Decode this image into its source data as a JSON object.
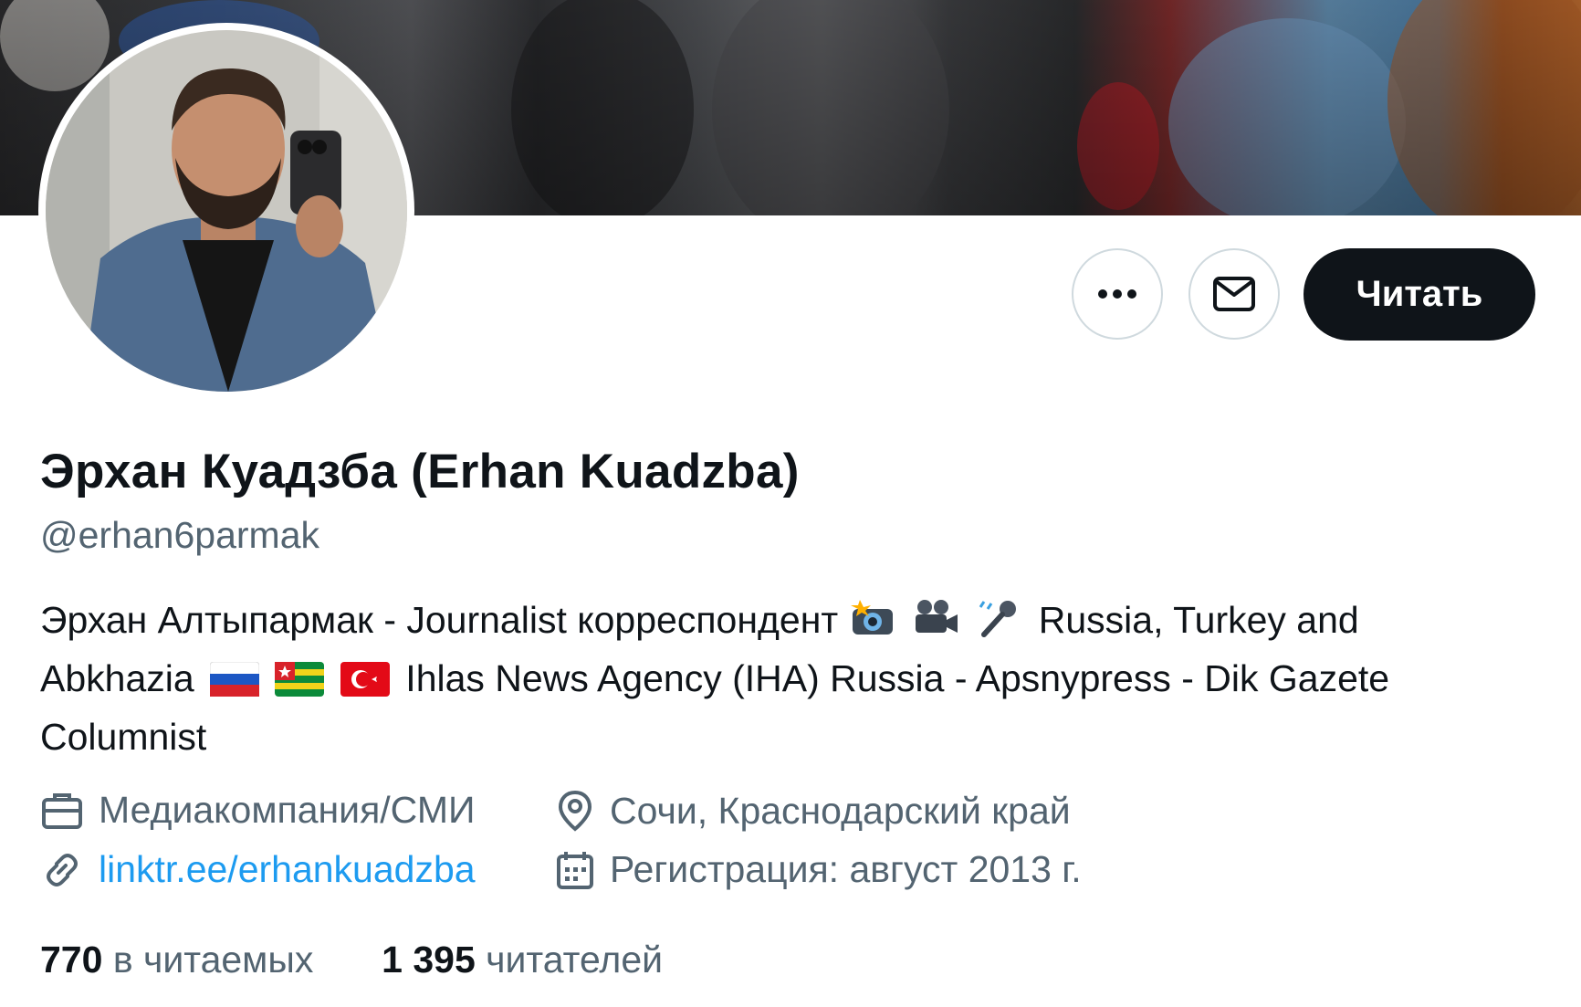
{
  "profile": {
    "display_name": "Эрхан Куадзба (Erhan Kuadzba)",
    "handle": "@erhan6parmak",
    "bio_line1_text": "Эрхан Алтыпармак - Journalist корреспондент",
    "bio_line1_tail": "Russia, Turkey and",
    "bio_line2_head": "Abkhazia",
    "bio_line2_tail": "Ihlas News Agency (IHA) Russia - Apsnypress - Dik Gazete",
    "bio_line3": "Columnist",
    "bio_emojis": [
      "camera-flash-icon",
      "movie-camera-icon",
      "microphone-icon"
    ],
    "bio_flags": [
      "russia-flag-icon",
      "abkhazia-flag-icon",
      "turkey-flag-icon"
    ]
  },
  "actions": {
    "more_icon": "ellipsis-icon",
    "message_icon": "envelope-icon",
    "follow_label": "Читать"
  },
  "meta": {
    "category": "Медиакомпания/СМИ",
    "location": "Сочи, Краснодарский край",
    "website": "linktr.ee/erhankuadzba",
    "joined": "Регистрация: август 2013 г."
  },
  "stats": {
    "following_count": "770",
    "following_label": "в читаемых",
    "followers_count": "1 395",
    "followers_label": "читателей"
  },
  "colors": {
    "text_primary": "#0f1419",
    "text_secondary": "#536471",
    "link": "#1d9bf0",
    "button_dark": "#0f1419",
    "border": "#cfd9de"
  }
}
